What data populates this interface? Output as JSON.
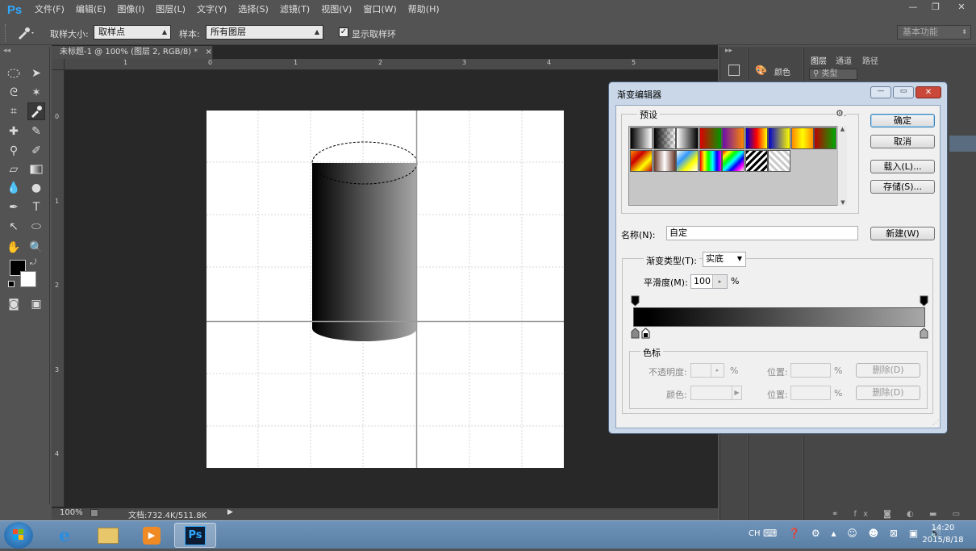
{
  "app": {
    "logo": "Ps"
  },
  "menu": [
    "文件(F)",
    "编辑(E)",
    "图像(I)",
    "图层(L)",
    "文字(Y)",
    "选择(S)",
    "滤镜(T)",
    "视图(V)",
    "窗口(W)",
    "帮助(H)"
  ],
  "options_bar": {
    "sample_size_label": "取样大小:",
    "sample_size_value": "取样点",
    "sample_label": "样本:",
    "sample_value": "所有图层",
    "show_ring_label": "显示取样环",
    "workspace": "基本功能"
  },
  "document": {
    "tab_title": "未标题-1 @ 100% (图层 2, RGB/8) *",
    "close": "×",
    "ruler_top": [
      "0",
      "1",
      "2",
      "3",
      "4",
      "5"
    ],
    "ruler_left": [
      "0",
      "1",
      "2",
      "3",
      "4"
    ]
  },
  "status": {
    "zoom": "100%",
    "doc_info": "文档:732.4K/511.8K"
  },
  "panels": {
    "color_tab": "颜色",
    "tabs": [
      "图层",
      "通道",
      "路径"
    ],
    "filter_kind": "类型"
  },
  "dialog": {
    "title": "渐变编辑器",
    "presets_label": "预设",
    "ok": "确定",
    "cancel": "取消",
    "load": "载入(L)...",
    "save": "存储(S)...",
    "name_label": "名称(N):",
    "name_value": "自定",
    "new_button": "新建(W)",
    "gradient_type_label": "渐变类型(T):",
    "gradient_type_value": "实底",
    "smoothness_label": "平滑度(M):",
    "smoothness_value": "100",
    "percent": "%",
    "stops_group": "色标",
    "opacity_label": "不透明度:",
    "color_label": "颜色:",
    "location_label": "位置:",
    "delete_label": "删除(D)",
    "swatches": [
      "linear-gradient(90deg,#000,#fff)",
      "linear-gradient(90deg,#000,transparent)",
      "linear-gradient(90deg,#fff,#000)",
      "linear-gradient(90deg,#d00,#090)",
      "linear-gradient(90deg,#6a0dad,#f80)",
      "linear-gradient(90deg,#00c,#f00,#ff0)",
      "linear-gradient(90deg,#00c,#ff0)",
      "linear-gradient(90deg,#f80,#ff0,#f80)",
      "linear-gradient(90deg,#b00,#0a0)",
      "linear-gradient(135deg,#f80,#c00,#ff0,#c00)",
      "linear-gradient(90deg,#6b3a2a,#fff,#6b3a2a)",
      "linear-gradient(135deg,#ffe,#39f,#ff0,#fff)",
      "linear-gradient(90deg,#f00,#ff0,#0f0,#0ff,#00f,#f0f)",
      "linear-gradient(135deg,#f00,#ff0,#0f0,#0ff,#00f,#f0f,#fff)",
      "repeating-linear-gradient(135deg,#000 0 3px,#fff 3px 6px)",
      "repeating-linear-gradient(45deg,#ccc 0 3px,#fff 3px 6px)"
    ]
  },
  "taskbar": {
    "ime": "CH",
    "time": "14:20",
    "date": "2015/8/18",
    "ps_label": "Ps"
  }
}
